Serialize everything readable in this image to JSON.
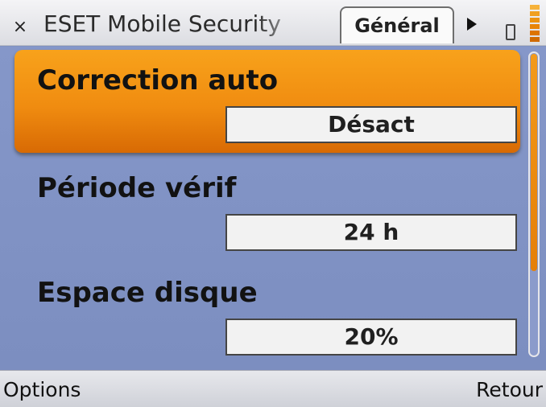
{
  "titlebar": {
    "close_icon": "×",
    "title": "ESET Mobile Security",
    "active_tab": "Général"
  },
  "settings": [
    {
      "label": "Correction auto",
      "value": "Désact",
      "selected": true
    },
    {
      "label": "Période vérif",
      "value": "24 h",
      "selected": false
    },
    {
      "label": "Espace disque",
      "value": "20%",
      "selected": false
    }
  ],
  "softkeys": {
    "left": "Options",
    "right": "Retour"
  },
  "colors": {
    "accent": "#f08c10",
    "background": "#7f91c0"
  }
}
